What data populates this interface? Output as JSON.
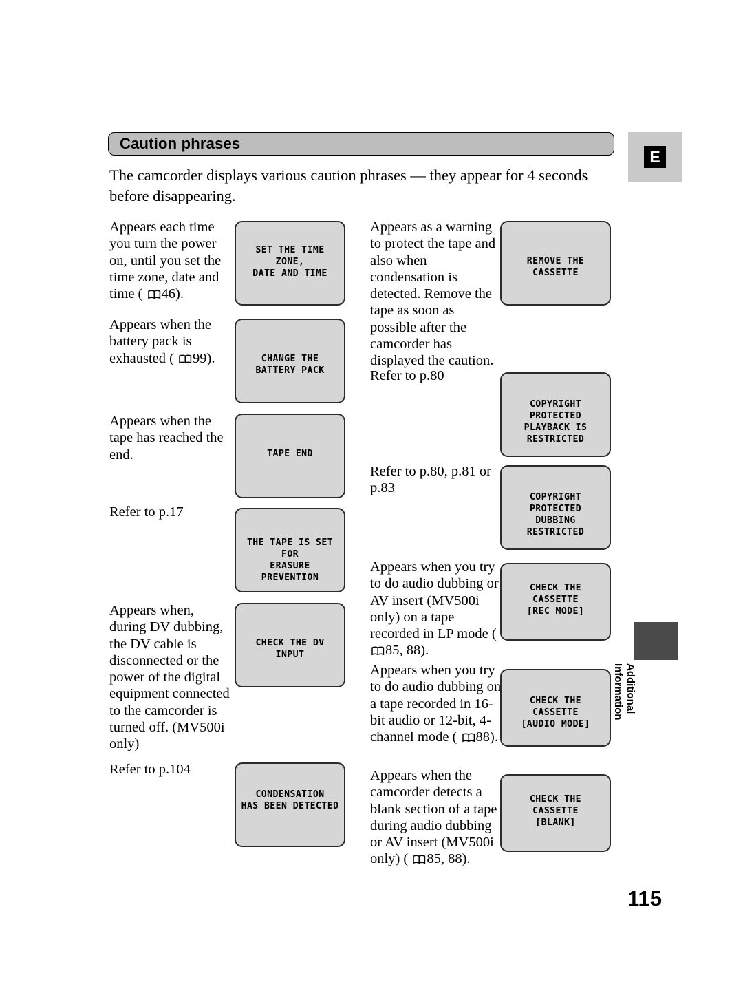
{
  "page": {
    "number": "115",
    "language_tab": "E",
    "side_running_head": "Additional\nInformation"
  },
  "header": {
    "title": "Caution phrases"
  },
  "intro": {
    "text": "The camcorder displays various caution phrases — they appear for 4 seconds before disappearing."
  },
  "left_column": {
    "blocks": [
      {
        "id": "set-time-zone",
        "text_before": "Appears each time you turn the power on, until you set the time zone, date and time ( ",
        "page_ref": "46",
        "text_after": ")."
      },
      {
        "id": "change-battery",
        "text_before": "Appears when the battery pack is exhausted ( ",
        "page_ref": "99",
        "text_after": ")."
      },
      {
        "id": "tape-end",
        "text_before": "Appears when the tape has reached the end.",
        "page_ref": "",
        "text_after": ""
      },
      {
        "id": "erasure-prevention",
        "text_before": "Refer to p.17",
        "page_ref": "",
        "text_after": ""
      },
      {
        "id": "check-dv-input",
        "text_before": "Appears when, during DV dubbing, the DV cable is disconnected or the power of the digital equipment connected to the camcorder is turned off. (MV500i only)",
        "page_ref": "",
        "text_after": ""
      },
      {
        "id": "condensation",
        "text_before": "Refer to p.104",
        "page_ref": "",
        "text_after": ""
      }
    ],
    "lcd_boxes": [
      {
        "id": "lcd-set-time-zone",
        "text": "SET THE TIME ZONE,\nDATE AND TIME"
      },
      {
        "id": "lcd-change-battery",
        "text": "CHANGE THE BATTERY PACK"
      },
      {
        "id": "lcd-tape-end",
        "text": "TAPE END"
      },
      {
        "id": "lcd-erasure-prevention",
        "text": "THE TAPE IS SET FOR\nERASURE PREVENTION"
      },
      {
        "id": "lcd-check-dv-input",
        "text": "CHECK THE DV INPUT"
      },
      {
        "id": "lcd-condensation",
        "text": "CONDENSATION\nHAS BEEN DETECTED"
      }
    ]
  },
  "right_column": {
    "blocks": [
      {
        "id": "remove-cassette",
        "text_before": "Appears as a warning to protect the tape and also when condensation is detected. Remove the tape as soon as possible after the camcorder has displayed the caution.",
        "page_ref": "",
        "text_after": ""
      },
      {
        "id": "refer-80",
        "text_before": "Refer to p.80",
        "page_ref": "",
        "text_after": ""
      },
      {
        "id": "refer-80-81-83",
        "text_before": "Refer to p.80, p.81 or p.83",
        "page_ref": "",
        "text_after": ""
      },
      {
        "id": "check-cassette-rec",
        "text_before": "Appears when you try to do audio dubbing or AV insert (MV500i only) on a tape recorded in LP mode ( ",
        "page_ref": "85, 88",
        "text_after": ")."
      },
      {
        "id": "check-cassette-audio",
        "text_before": "Appears when you try to do audio dubbing on a tape recorded in 16-bit audio or 12-bit, 4-channel mode ( ",
        "page_ref": "88",
        "text_after": ")."
      },
      {
        "id": "check-cassette-blank",
        "text_before": "Appears when the camcorder detects a blank section of a tape during audio dubbing or AV insert (MV500i only) ( ",
        "page_ref": "85, 88",
        "text_after": ")."
      }
    ],
    "lcd_boxes": [
      {
        "id": "lcd-remove-cassette",
        "text": "REMOVE THE CASSETTE"
      },
      {
        "id": "lcd-copyright-playback",
        "text": "COPYRIGHT PROTECTED\nPLAYBACK IS RESTRICTED"
      },
      {
        "id": "lcd-copyright-dubbing",
        "text": "COPYRIGHT PROTECTED\nDUBBING RESTRICTED"
      },
      {
        "id": "lcd-check-cassette-rec",
        "text": "CHECK THE CASSETTE\n[REC MODE]"
      },
      {
        "id": "lcd-check-cassette-audio",
        "text": "CHECK THE CASSETTE\n[AUDIO MODE]"
      },
      {
        "id": "lcd-check-cassette-blank",
        "text": "CHECK THE CASSETTE\n[BLANK]"
      }
    ]
  },
  "colors": {
    "header_bar": "#bdbdbd",
    "lcd_fill": "#d6d6d6",
    "lcd_border": "#2b2b2b",
    "tab_bg": "#c9c9c9",
    "side_marker": "#4a4a4a"
  }
}
